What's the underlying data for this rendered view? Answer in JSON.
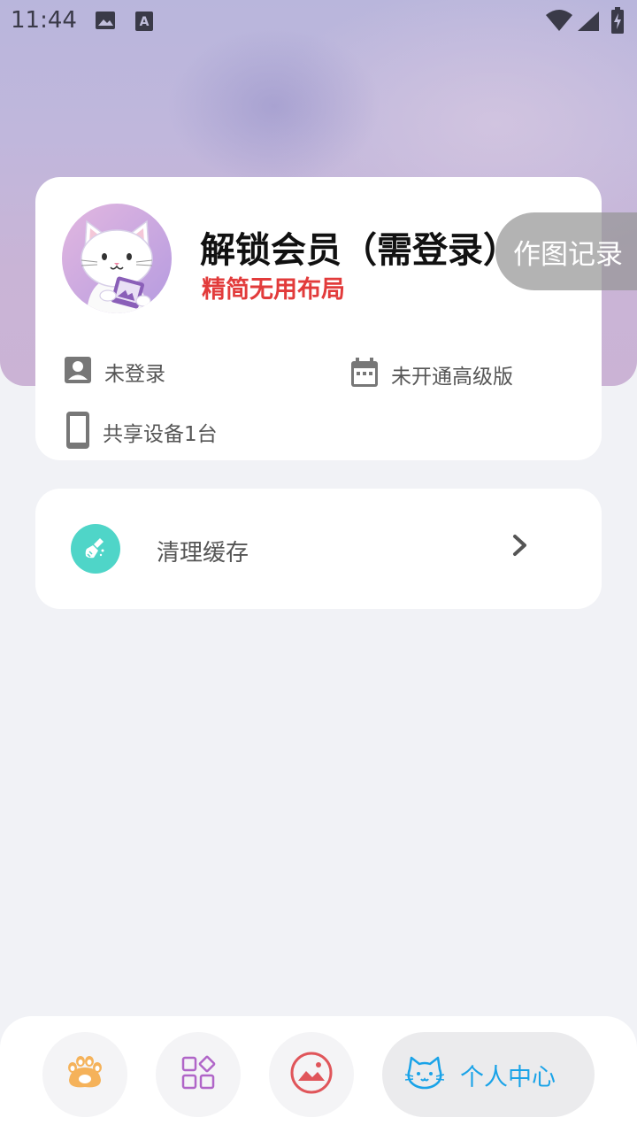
{
  "status_bar": {
    "time": "11:44",
    "icons": [
      "image-icon",
      "text-a-icon",
      "wifi-icon",
      "signal-icon",
      "battery-charging-icon"
    ]
  },
  "profile": {
    "title": "解锁会员（需登录）",
    "subtitle": "精简无用布局",
    "avatar_icon": "cat-avatar-icon",
    "login_status": "未登录",
    "membership_status": "未开通高级版",
    "devices": "共享设备1台"
  },
  "floating": {
    "history_label": "作图记录"
  },
  "cache": {
    "label": "清理缓存",
    "icon": "broom-icon",
    "accent_color": "#4fd5c8"
  },
  "bottom_nav": {
    "items": [
      {
        "icon": "paw-icon"
      },
      {
        "icon": "apps-grid-icon"
      },
      {
        "icon": "picture-icon"
      },
      {
        "icon": "cat-face-icon",
        "label": "个人中心",
        "active": true
      }
    ],
    "active_color": "#1aa3e8"
  },
  "colors": {
    "accent_red": "#e23b3b",
    "background": "#f1f2f6"
  }
}
